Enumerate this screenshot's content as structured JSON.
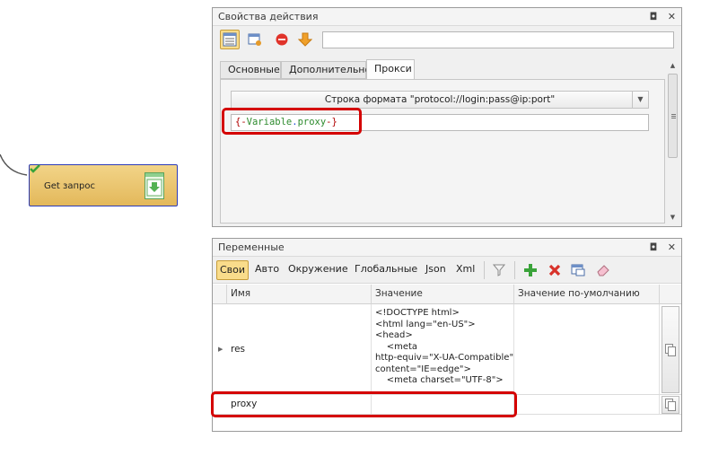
{
  "flow_node": {
    "label": "Get запрос"
  },
  "props_panel": {
    "title": "Свойства действия",
    "ctrl_pin": "◘",
    "ctrl_close": "✕",
    "toolbar_input_value": "",
    "tabs": [
      {
        "label": "Основные"
      },
      {
        "label": "Дополнительно"
      },
      {
        "label": "Прокси"
      }
    ],
    "format_label": "Строка формата \"protocol://login:pass@ip:port\"",
    "proxy_value": {
      "open": "{-",
      "var": "Variable",
      "dot": ".",
      "name": "proxy",
      "close": "-}"
    }
  },
  "vars_panel": {
    "title": "Переменные",
    "ctrl_pin": "◘",
    "ctrl_close": "✕",
    "tabs": [
      {
        "label": "Свои"
      },
      {
        "label": "Авто"
      },
      {
        "label": "Окружение"
      },
      {
        "label": "Глобальные"
      },
      {
        "label": "Json"
      },
      {
        "label": "Xml"
      }
    ],
    "columns": [
      "Имя",
      "Значение",
      "Значение по-умолчанию"
    ],
    "rows": [
      {
        "name": "res",
        "value": "<!DOCTYPE html>\n<html lang=\"en-US\">\n<head>\n    <meta\nhttp-equiv=\"X-UA-Compatible\"\ncontent=\"IE=edge\">\n    <meta charset=\"UTF-8\">",
        "default": ""
      },
      {
        "name": "proxy",
        "value": "",
        "default": ""
      }
    ]
  },
  "colors": {
    "highlight": "#d40000",
    "active_tab": "#f9dc8b",
    "node_border": "#2b3bb8"
  }
}
